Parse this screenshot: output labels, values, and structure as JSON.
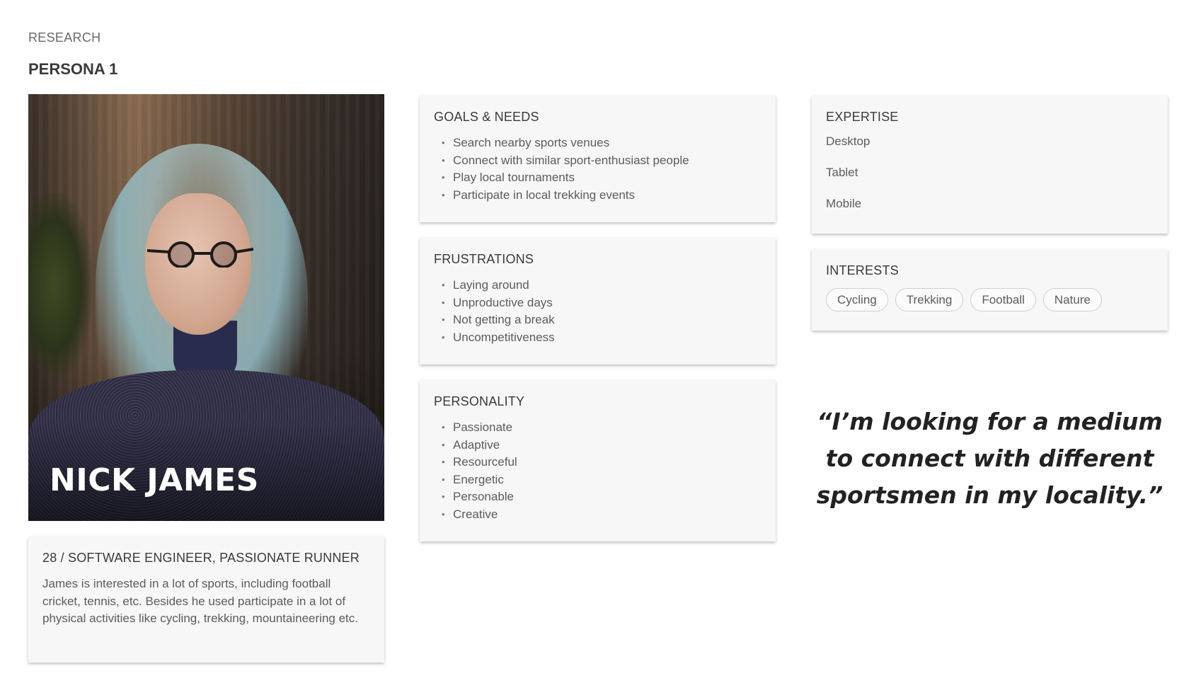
{
  "header": {
    "section": "RESEARCH",
    "title": "PERSONA 1"
  },
  "persona": {
    "name": "NICK JAMES",
    "photo_icon": "person-portrait-photo"
  },
  "bio": {
    "title": "28 / SOFTWARE ENGINEER, PASSIONATE RUNNER",
    "text": "James is interested in a lot of sports, including football cricket, tennis, etc. Besides he used participate in a lot of physical activities like cycling, trekking, mountaineering etc."
  },
  "goals": {
    "title": "GOALS & NEEDS",
    "items": [
      "Search nearby sports venues",
      "Connect with similar sport-enthusiast people",
      "Play local tournaments",
      "Participate in local trekking events"
    ]
  },
  "frustrations": {
    "title": "FRUSTRATIONS",
    "items": [
      "Laying around",
      "Unproductive days",
      "Not getting a break",
      "Uncompetitiveness"
    ]
  },
  "personality": {
    "title": "PERSONALITY",
    "items": [
      "Passionate",
      "Adaptive",
      "Resourceful",
      "Energetic",
      "Personable",
      "Creative"
    ]
  },
  "expertise": {
    "title": "EXPERTISE",
    "items": [
      "Desktop",
      "Tablet",
      "Mobile"
    ]
  },
  "interests": {
    "title": "INTERESTS",
    "items": [
      "Cycling",
      "Trekking",
      "Football",
      "Nature"
    ]
  },
  "quote": "“I’m looking for a medium to connect with different sportsmen in my locality.”"
}
